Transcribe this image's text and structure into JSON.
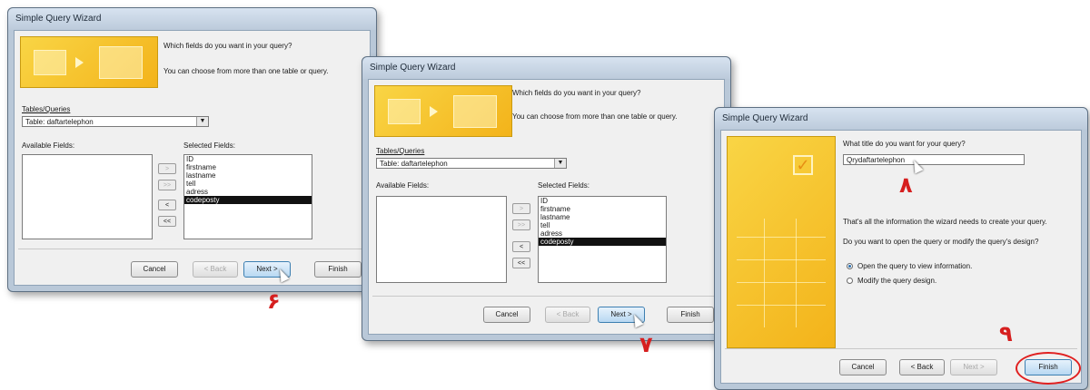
{
  "windows": [
    {
      "title": "Simple Query Wizard",
      "question1": "Which fields do you want in your query?",
      "question2": "You can choose from more than one table or query.",
      "tables_label": "Tables/Queries",
      "combo_value": "Table: daftartelephon",
      "available_label": "Available Fields:",
      "selected_label": "Selected Fields:",
      "selected_fields": [
        "ID",
        "firstname",
        "lastname",
        "tell",
        "adress",
        "codeposty"
      ],
      "selected_highlight": "codeposty",
      "move_buttons": [
        ">",
        ">>",
        "<",
        "<<"
      ],
      "buttons": {
        "cancel": "Cancel",
        "back": "< Back",
        "next": "Next >",
        "finish": "Finish"
      },
      "step_number": "۶"
    },
    {
      "title": "Simple Query Wizard",
      "question1": "Which fields do you want in your query?",
      "question2": "You can choose from more than one table or query.",
      "tables_label": "Tables/Queries",
      "combo_value": "Table: daftartelephon",
      "available_label": "Available Fields:",
      "selected_label": "Selected Fields:",
      "selected_fields": [
        "ID",
        "firstname",
        "lastname",
        "tell",
        "adress",
        "codeposty"
      ],
      "selected_highlight": "codeposty",
      "move_buttons": [
        ">",
        ">>",
        "<",
        "<<"
      ],
      "buttons": {
        "cancel": "Cancel",
        "back": "< Back",
        "next": "Next >",
        "finish": "Finish"
      },
      "step_number": "۷"
    },
    {
      "title": "Simple Query Wizard",
      "question": "What title do you want for your query?",
      "title_value": "Qrydaftartelephon",
      "title_step": "۸",
      "info1": "That's all the information the wizard needs to create your query.",
      "info2": "Do you want to open the query or modify the query's design?",
      "option_open": "Open the query to view information.",
      "option_modify": "Modify the query design.",
      "selected_option": "open",
      "buttons": {
        "cancel": "Cancel",
        "back": "< Back",
        "next": "Next >",
        "finish": "Finish"
      },
      "finish_step": "۹"
    }
  ],
  "colors": {
    "banner": "#f3b31a",
    "step_red": "#d61f1f",
    "title_bar": "#bccbdb"
  }
}
